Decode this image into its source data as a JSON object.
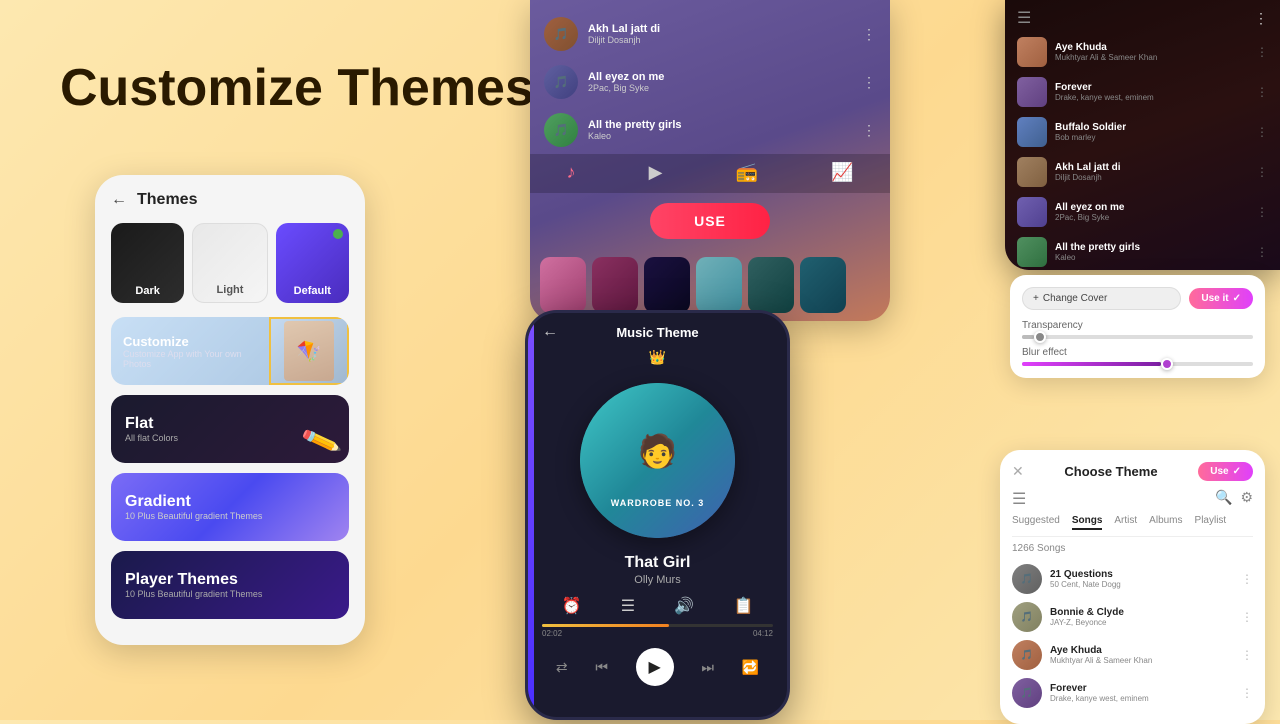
{
  "mainTitle": "Customize Themes",
  "themesPanel": {
    "headerTitle": "Themes",
    "options": [
      "Dark",
      "Light",
      "Default"
    ],
    "cards": [
      {
        "id": "customize",
        "title": "Customize",
        "subtitle": "Customize App with Your own Photos"
      },
      {
        "id": "flat",
        "title": "Flat",
        "subtitle": "All flat Colors"
      },
      {
        "id": "gradient",
        "title": "Gradient",
        "subtitle": "10 Plus Beautiful gradient Themes"
      },
      {
        "id": "player",
        "title": "Player Themes",
        "subtitle": "10 Plus Beautiful gradient Themes"
      }
    ]
  },
  "centerTopPanel": {
    "songs": [
      {
        "title": "Akh Lal jatt di",
        "artist": "Diljit Dosanjh"
      },
      {
        "title": "All eyez on me",
        "artist": "2Pac, Big Syke"
      },
      {
        "title": "All the pretty girls",
        "artist": "Kaleo"
      }
    ],
    "useButtonLabel": "USE"
  },
  "musicPhone": {
    "headerTitle": "Music Theme",
    "songTitle": "That Girl",
    "songArtist": "Olly Murs",
    "albumLabel": "WARDROBE NO. 3",
    "timeStart": "02:02",
    "timeEnd": "04:12"
  },
  "rightTopPanel": {
    "songs": [
      {
        "title": "Aye Khuda",
        "artist": "Mukhtyar Ali & Sameer Khan"
      },
      {
        "title": "Forever",
        "artist": "Drake, kanye west, eminem"
      },
      {
        "title": "Buffalo Soldier",
        "artist": "Bob marley"
      },
      {
        "title": "Akh Lal jatt di",
        "artist": "Diljit Dosanjh"
      },
      {
        "title": "All eyez on me",
        "artist": "2Pac, Big Syke"
      },
      {
        "title": "All the pretty girls",
        "artist": "Kaleo"
      }
    ]
  },
  "rightMidPanel": {
    "changeCoverLabel": "Change Cover",
    "useItLabel": "Use it",
    "transparencyLabel": "Transparency",
    "blurLabel": "Blur effect",
    "transparencyFillPercent": 5,
    "blurFillPercent": 60
  },
  "rightBottomPanel": {
    "title": "Choose Theme",
    "useLabel": "Use",
    "tabs": [
      "Suggested",
      "Songs",
      "Artist",
      "Albums",
      "Playlist"
    ],
    "activeTab": "Songs",
    "songCount": "1266 Songs",
    "songs": [
      {
        "title": "21 Questions",
        "artist": "50 Cent, Nate Dogg"
      },
      {
        "title": "Bonnie & Clyde",
        "artist": "JAY-Z, Beyonce"
      },
      {
        "title": "Aye Khuda",
        "artist": "Mukhtyar Ali & Sameer Khan"
      },
      {
        "title": "Forever",
        "artist": "Drake, kanye west, eminem"
      }
    ]
  },
  "swatchColors": [
    "#d070a0",
    "#8a3060",
    "#1a1040",
    "#70b0b8",
    "#306060",
    "#206070"
  ],
  "icons": {
    "backArrow": "←",
    "menu": "⋮",
    "hamburger": "☰",
    "search": "🔍",
    "filter": "⚙",
    "close": "✕",
    "check": "✓",
    "crown": "👑",
    "plus": "+",
    "shuffle": "⇄",
    "queue": "≡",
    "volume": "🔊",
    "list": "☰"
  }
}
